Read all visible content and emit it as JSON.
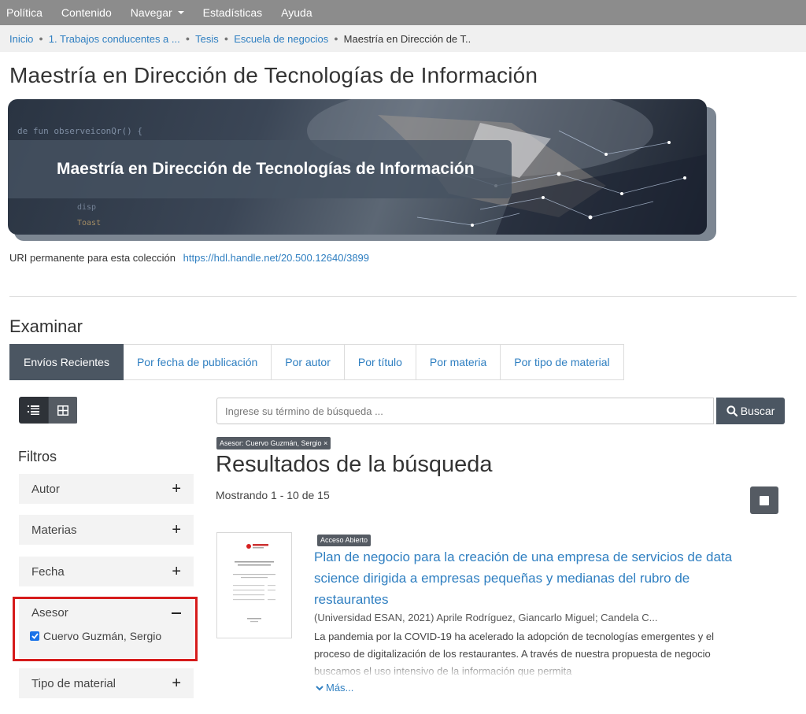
{
  "topnav": {
    "items": [
      "Política",
      "Contenido",
      "Navegar",
      "Estadísticas",
      "Ayuda"
    ]
  },
  "breadcrumb": {
    "items": [
      "Inicio",
      "1. Trabajos conducentes a ...",
      "Tesis",
      "Escuela de negocios",
      "Maestría en Dirección de T.."
    ]
  },
  "page_title": "Maestría en Dirección de Tecnologías de Información",
  "banner": {
    "label": "Maestría en Dirección de Tecnologías de Información",
    "code_lines": [
      "de fun observeiconQr() {",
      "disp",
      "Toast"
    ]
  },
  "uri": {
    "label": "URI permanente para esta colección",
    "link": "https://hdl.handle.net/20.500.12640/3899"
  },
  "examinar": {
    "title": "Examinar",
    "tabs": [
      "Envíos Recientes",
      "Por fecha de publicación",
      "Por autor",
      "Por título",
      "Por materia",
      "Por tipo de material"
    ]
  },
  "sidebar": {
    "filters_title": "Filtros",
    "facets": [
      {
        "label": "Autor",
        "toggle": "+"
      },
      {
        "label": "Materias",
        "toggle": "+"
      },
      {
        "label": "Fecha",
        "toggle": "+"
      },
      {
        "label": "Asesor",
        "toggle": "−"
      },
      {
        "label": "Tipo de material",
        "toggle": "+"
      }
    ],
    "asesor_option": "Cuervo Guzmán, Sergio"
  },
  "search": {
    "placeholder": "Ingrese su término de búsqueda ...",
    "button_label": "Buscar"
  },
  "results": {
    "active_filter": "Asesor: Cuervo Guzmán, Sergio ×",
    "title": "Resultados de la búsqueda",
    "showing": "Mostrando 1 - 10 de 15",
    "items": [
      {
        "access": "Acceso Abierto",
        "title": "Plan de negocio para la creación de una empresa de servicios de data science dirigida a empresas pequeñas y medianas del rubro de restaurantes",
        "meta": "(Universidad ESAN, 2021) Aprile Rodríguez, Giancarlo Miguel; Candela C...",
        "abstract": "La pandemia por la COVID-19 ha acelerado la adopción de tecnologías emergentes y el proceso de digitalización de los restaurantes. A través de nuestra propuesta de negocio buscamos el uso intensivo de la información que permita",
        "more": "Más..."
      }
    ]
  },
  "colors": {
    "accent": "#2f7fc1",
    "dark_button": "#4b5662",
    "highlight": "#d61b1b"
  }
}
